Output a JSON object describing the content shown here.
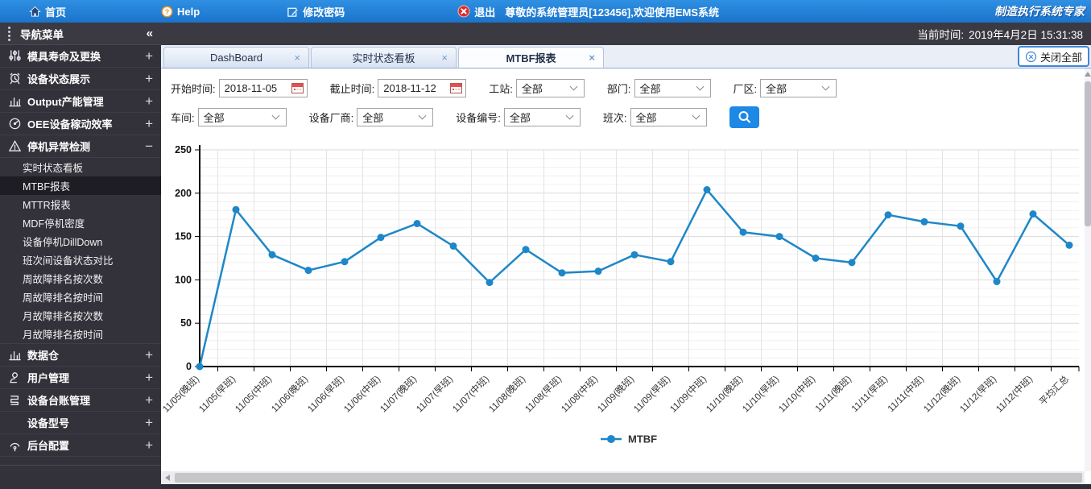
{
  "topbar": {
    "home_label": "首页",
    "help_label": "Help",
    "change_password_label": "修改密码",
    "logout_label": "退出",
    "welcome_text": "尊敬的系统管理员[123456],欢迎使用EMS系统",
    "brand": "制造执行系统专家"
  },
  "statusbar": {
    "current_time_label": "当前时间:",
    "current_time": "2019年4月2日 15:31:38"
  },
  "sidebar": {
    "title": "导航菜单",
    "collapse_glyph": "«",
    "items": [
      {
        "label": "模具寿命及更换",
        "icon": "sliders-icon",
        "state": "collapsed"
      },
      {
        "label": "设备状态展示",
        "icon": "alarm-bell-icon",
        "state": "collapsed"
      },
      {
        "label": "Output产能管理",
        "icon": "bar-chart-icon",
        "state": "collapsed"
      },
      {
        "label": "OEE设备稼动效率",
        "icon": "gauge-icon",
        "state": "collapsed"
      },
      {
        "label": "停机异常检测",
        "icon": "warning-triangle-icon",
        "state": "expanded",
        "children": [
          "实时状态看板",
          "MTBF报表",
          "MTTR报表",
          "MDF停机密度",
          "设备停机DillDown",
          "班次间设备状态对比",
          "周故障排名按次数",
          "周故障排名按时间",
          "月故障排名按次数",
          "月故障排名按时间"
        ],
        "active_child": "MTBF报表"
      },
      {
        "label": "数据仓",
        "icon": "bar-chart-icon",
        "state": "collapsed"
      },
      {
        "label": "用户管理",
        "icon": "user-icon",
        "state": "collapsed"
      },
      {
        "label": "设备台账管理",
        "icon": "ledger-icon",
        "state": "collapsed"
      },
      {
        "label": "设备型号",
        "icon": "none",
        "state": "collapsed"
      },
      {
        "label": "后台配置",
        "icon": "config-icon",
        "state": "collapsed"
      }
    ]
  },
  "tabs": {
    "items": [
      {
        "label": "DashBoard",
        "active": false
      },
      {
        "label": "实时状态看板",
        "active": false
      },
      {
        "label": "MTBF报表",
        "active": true
      }
    ],
    "close_label": "×",
    "close_all_label": "关闭全部"
  },
  "filters": {
    "rows": [
      [
        {
          "name": "start-time",
          "label": "开始时间:",
          "value": "2018-11-05",
          "type": "date"
        },
        {
          "name": "end-time",
          "label": "截止时间:",
          "value": "2018-11-12",
          "type": "date"
        },
        {
          "name": "station",
          "label": "工站:",
          "value": "全部",
          "type": "select",
          "w": "w85"
        },
        {
          "name": "department",
          "label": "部门:",
          "value": "全部",
          "type": "select",
          "w": "w95"
        },
        {
          "name": "factory-area",
          "label": "厂区:",
          "value": "全部",
          "type": "select",
          "w": "w95"
        }
      ],
      [
        {
          "name": "workshop",
          "label": "车间:",
          "value": "全部",
          "type": "select"
        },
        {
          "name": "equipment-vendor",
          "label": "设备厂商:",
          "value": "全部",
          "type": "select",
          "w": "w95"
        },
        {
          "name": "equipment-id",
          "label": "设备编号:",
          "value": "全部",
          "type": "select",
          "w": "w95"
        },
        {
          "name": "shift",
          "label": "班次:",
          "value": "全部",
          "type": "select",
          "w": "w95"
        }
      ]
    ],
    "search_icon": "search-icon"
  },
  "chart_data": {
    "type": "line",
    "title": "",
    "xlabel": "",
    "ylabel": "",
    "ylim": [
      0,
      250
    ],
    "yticks": [
      0,
      50,
      100,
      150,
      200,
      250
    ],
    "minor_grid_step": 10,
    "grid": true,
    "legend_position": "bottom",
    "line_color": "#1e87c8",
    "categories": [
      "11/05(晚班)",
      "11/05(早班)",
      "11/05(中班)",
      "11/06(晚班)",
      "11/06(早班)",
      "11/06(中班)",
      "11/07(晚班)",
      "11/07(早班)",
      "11/07(中班)",
      "11/08(晚班)",
      "11/08(早班)",
      "11/08(中班)",
      "11/09(晚班)",
      "11/09(早班)",
      "11/09(中班)",
      "11/10(晚班)",
      "11/10(早班)",
      "11/10(中班)",
      "11/11(晚班)",
      "11/11(早班)",
      "11/11(中班)",
      "11/12(晚班)",
      "11/12(早班)",
      "11/12(中班)",
      "平均汇总"
    ],
    "series": [
      {
        "name": "MTBF",
        "values": [
          0,
          181,
          129,
          111,
          121,
          149,
          165,
          139,
          97,
          135,
          108,
          110,
          129,
          121,
          204,
          155,
          150,
          125,
          120,
          175,
          167,
          162,
          98,
          176,
          140
        ]
      }
    ]
  }
}
